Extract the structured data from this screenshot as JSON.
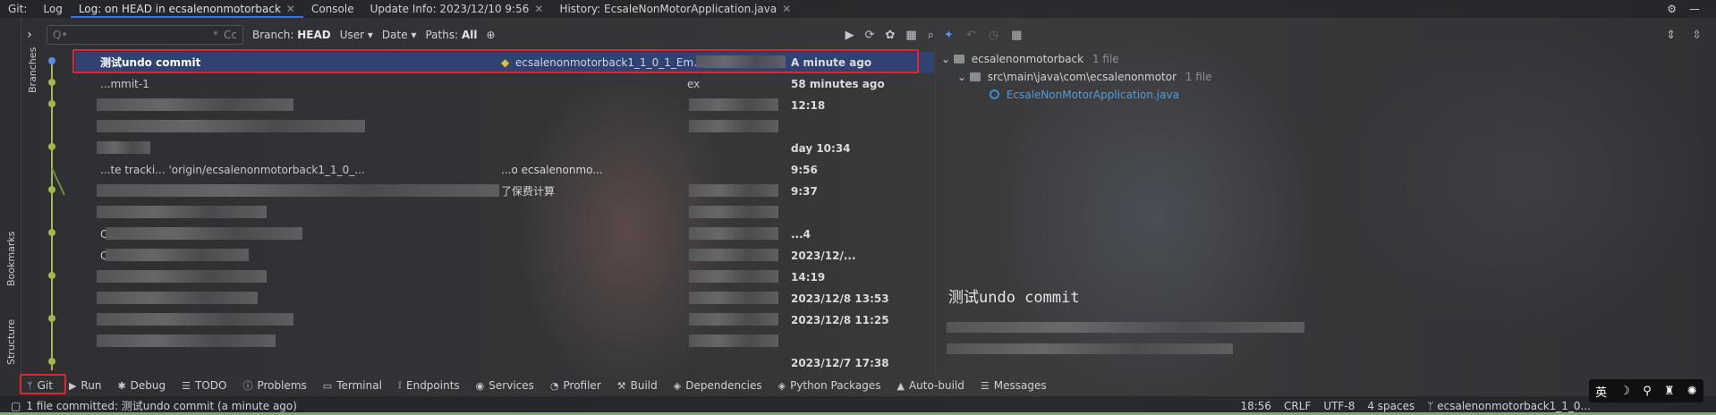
{
  "tabs": {
    "git": "Git:",
    "log": "Log",
    "log_head": "Log: on HEAD in ecsalenonmotorback",
    "console": "Console",
    "update_info": "Update Info: 2023/12/10 9:56",
    "history": "History: EcsaleNonMotorApplication.java",
    "close_glyph": "✕"
  },
  "side": {
    "branches": "Branches",
    "bookmarks": "Bookmarks",
    "structure": "Structure"
  },
  "toolbar": {
    "search_placeholder": "Q•",
    "regex": "Cc",
    "branch_label": "Branch:",
    "branch_value": "HEAD",
    "user": "User",
    "date": "Date",
    "paths_label": "Paths:",
    "paths_value": "All"
  },
  "commits": [
    {
      "message": "测试undo commit",
      "tag": "ecsalenonmotorback1_1_0_1_Em...",
      "author": "",
      "date": "A minute ago"
    },
    {
      "message": "...mmit-1",
      "tag": "",
      "author": "ex",
      "date": "58 minutes ago"
    },
    {
      "message": "",
      "tag": "",
      "author": "",
      "date": "12:18"
    },
    {
      "message": "",
      "tag": "",
      "author": "",
      "date": ""
    },
    {
      "message": "",
      "tag": "",
      "author": "",
      "date": "day 10:34"
    },
    {
      "message": "...te tracki...   'origin/ecsalenonmotorback1_1_0_...",
      "tag": "...o ecsalenonmo...",
      "author": "",
      "date": "9:56"
    },
    {
      "message": "",
      "tag": "了保费计算",
      "author": "",
      "date": "9:37"
    },
    {
      "message": "",
      "tag": "",
      "author": "",
      "date": ""
    },
    {
      "message": "C...",
      "tag": "",
      "author": "",
      "date": "...4"
    },
    {
      "message": "C...",
      "tag": "",
      "author": "",
      "date": "2023/12/..."
    },
    {
      "message": "",
      "tag": "",
      "author": "",
      "date": "14:19"
    },
    {
      "message": "",
      "tag": "",
      "author": "",
      "date": "2023/12/8 13:53"
    },
    {
      "message": "",
      "tag": "",
      "author": "",
      "date": "2023/12/8 11:25"
    },
    {
      "message": "",
      "tag": "",
      "author": "",
      "date": ""
    },
    {
      "message": "",
      "tag": "",
      "author": "",
      "date": "2023/12/7 17:38"
    }
  ],
  "tree": {
    "root": "ecsalenonmotorback",
    "root_count": "1 file",
    "folder": "src\\main\\java\\com\\ecsalenonmotor",
    "folder_count": "1 file",
    "file": "EcsaleNonMotorApplication.java"
  },
  "detail": {
    "title": "测试undo commit"
  },
  "toolwindows": [
    "Git",
    "Run",
    "Debug",
    "TODO",
    "Problems",
    "Terminal",
    "Endpoints",
    "Services",
    "Profiler",
    "Build",
    "Dependencies",
    "Python Packages",
    "Auto-build",
    "Messages"
  ],
  "status": {
    "message": "1 file committed: 测试undo commit (a minute ago)",
    "time": "18:56",
    "line_sep": "CRLF",
    "encoding": "UTF-8",
    "indent": "4 spaces",
    "branch": "ecsalenonmotorback1_1_0..."
  },
  "ime": {
    "lang": "英"
  },
  "colors": {
    "selection": "#2e4372",
    "highlight_box": "#e5232f",
    "accent": "#3574f0",
    "graph": "#a7b84a"
  }
}
